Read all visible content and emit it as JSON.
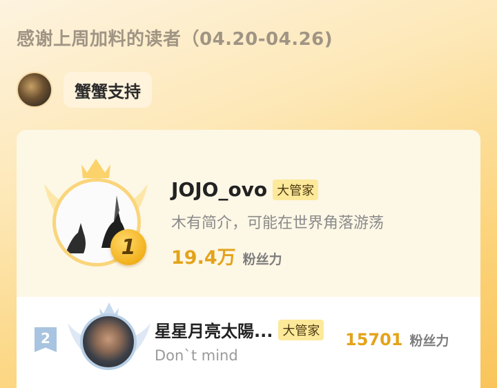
{
  "header": {
    "title": "感谢上周加料的读者（04.20-04.26)"
  },
  "supporter": {
    "label": "蟹蟹支持"
  },
  "ranking": [
    {
      "rank": "1",
      "name": "JOJO_ovo",
      "badge": "大管家",
      "description": "木有简介，可能在世界角落游荡",
      "fans_count": "19.4万",
      "fans_label": "粉丝力"
    },
    {
      "rank": "2",
      "name": "星星月亮太陽...",
      "badge": "大管家",
      "description": "Don`t mind",
      "fans_count": "15701",
      "fans_label": "粉丝力"
    }
  ],
  "colors": {
    "accent": "#e4a31a",
    "badge_bg": "#fde99a",
    "gold_emblem": "#fad57a",
    "silver_emblem": "#b8cfe6"
  },
  "icons": {
    "first_emblem": "crown-wings-icon",
    "second_emblem": "crown-wings-icon",
    "rank_2_flag": "rank-flag-icon"
  }
}
